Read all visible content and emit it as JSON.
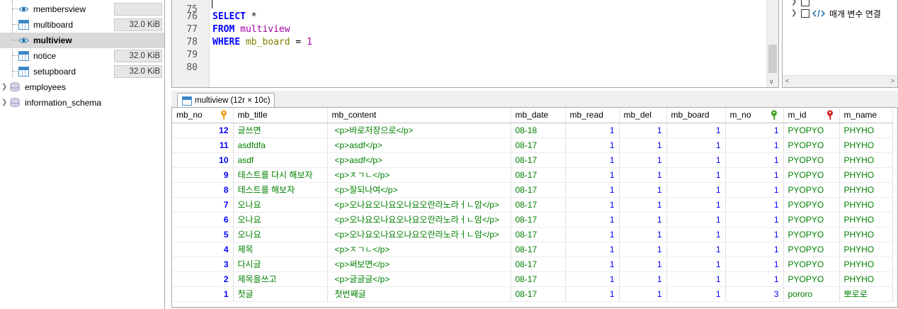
{
  "tree": {
    "items": [
      {
        "label": "membersview",
        "kind": "view",
        "size": ""
      },
      {
        "label": "multiboard",
        "kind": "table",
        "size": "32.0 KiB"
      },
      {
        "label": "multiview",
        "kind": "view",
        "size": ""
      },
      {
        "label": "notice",
        "kind": "table",
        "size": "32.0 KiB"
      },
      {
        "label": "setupboard",
        "kind": "table",
        "size": "32.0 KiB"
      },
      {
        "label": "employees",
        "kind": "database",
        "size": ""
      },
      {
        "label": "information_schema",
        "kind": "database",
        "size": ""
      }
    ],
    "selected": "multiview"
  },
  "editor": {
    "lines": [
      {
        "no": "75",
        "text": ""
      },
      {
        "no": "76",
        "kw": "SELECT",
        "rest": " *"
      },
      {
        "no": "77",
        "kw": "FROM",
        "ident": "multiview"
      },
      {
        "no": "78",
        "kw": "WHERE",
        "col": "mb_board",
        "op": " = ",
        "num": "1"
      },
      {
        "no": "79",
        "text": ""
      },
      {
        "no": "80",
        "text": ""
      }
    ]
  },
  "right_panel": {
    "items": [
      {
        "label": "매개 변수 연결"
      }
    ]
  },
  "result": {
    "tab_label": "multiview (12r × 10c)",
    "columns": [
      "mb_no",
      "mb_title",
      "mb_content",
      "mb_date",
      "mb_read",
      "mb_del",
      "mb_board",
      "m_no",
      "m_id",
      "m_name"
    ],
    "key_colors": {
      "mb_no": "#f0a020",
      "m_no": "#40a020",
      "m_id": "#d02020"
    },
    "rows": [
      [
        "12",
        "글쓰면",
        "<p>바로저장으로</p>",
        "08-18",
        "1",
        "1",
        "1",
        "1",
        "PYOPYO",
        "PHYHO"
      ],
      [
        "11",
        "asdfdfa",
        "<p>asdf</p>",
        "08-17",
        "1",
        "1",
        "1",
        "1",
        "PYOPYO",
        "PHYHO"
      ],
      [
        "10",
        "asdf",
        "<p>asdf</p>",
        "08-17",
        "1",
        "1",
        "1",
        "1",
        "PYOPYO",
        "PHYHO"
      ],
      [
        "9",
        "테스트를 다시 해보자",
        "<p>ㅈㄱㄴ</p>",
        "08-17",
        "1",
        "1",
        "1",
        "1",
        "PYOPYO",
        "PHYHO"
      ],
      [
        "8",
        "테스트를 해보자",
        "<p>잘되나여</p>",
        "08-17",
        "1",
        "1",
        "1",
        "1",
        "PYOPYO",
        "PHYHO"
      ],
      [
        "7",
        "오나요",
        "<p>오나요오나요오나요오란라노라ㅓㄴ암</p>",
        "08-17",
        "1",
        "1",
        "1",
        "1",
        "PYOPYO",
        "PHYHO"
      ],
      [
        "6",
        "오나요",
        "<p>오나요오나요오나요오란라노라ㅓㄴ암</p>",
        "08-17",
        "1",
        "1",
        "1",
        "1",
        "PYOPYO",
        "PHYHO"
      ],
      [
        "5",
        "오나요",
        "<p>오나요오나요오나요오란라노라ㅓㄴ암</p>",
        "08-17",
        "1",
        "1",
        "1",
        "1",
        "PYOPYO",
        "PHYHO"
      ],
      [
        "4",
        "제목",
        "<p>ㅈㄱㄴ</p>",
        "08-17",
        "1",
        "1",
        "1",
        "1",
        "PYOPYO",
        "PHYHO"
      ],
      [
        "3",
        "다시글",
        "<p>써보면</p>",
        "08-17",
        "1",
        "1",
        "1",
        "1",
        "PYOPYO",
        "PHYHO"
      ],
      [
        "2",
        "제목을쓰고",
        "<p>글글글</p>",
        "08-17",
        "1",
        "1",
        "1",
        "1",
        "PYOPYO",
        "PHYHO"
      ],
      [
        "1",
        "첫글",
        "첫번째글",
        "08-17",
        "1",
        "1",
        "1",
        "3",
        "pororo",
        "뽀로로"
      ]
    ]
  }
}
